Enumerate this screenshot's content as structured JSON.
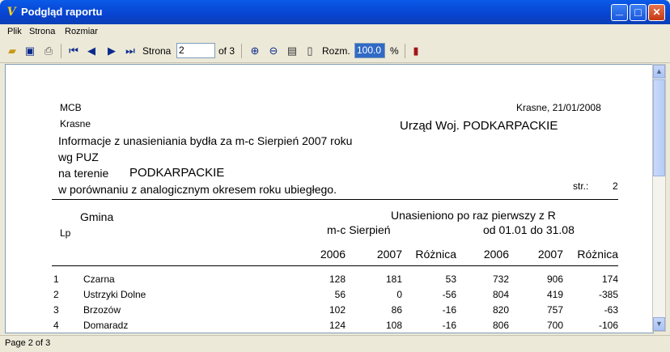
{
  "window": {
    "title": "Podgląd raportu",
    "minimize": "_",
    "maximize": "□",
    "close": "✕"
  },
  "menu": [
    "Plik",
    "Strona",
    "Rozmiar"
  ],
  "toolbar": {
    "page_label": "Strona",
    "page_value": "2",
    "page_of": "of 3",
    "zoom_label": "Rozm.",
    "zoom_value": "100.0",
    "zoom_unit": "%"
  },
  "report": {
    "company": "MCB",
    "place_date": "Krasne, 21/01/2008",
    "city": "Krasne",
    "recipient": "Urząd Woj. PODKARPACKIE",
    "line1": "Informacje z unasieniania bydła za  m-c Sierpień 2007 roku",
    "line2": "wg PUZ",
    "line3_label": "na terenie",
    "line3_region": "PODKARPACKIE",
    "line4": "w porównaniu z analogicznym okresem roku ubiegłego.",
    "page_label": "str.:",
    "page_number": "2",
    "header": {
      "gmina": "Gmina",
      "lp": "Lp",
      "group_title": "Unasieniono po raz pierwszy z R",
      "month_label": "m-c  Sierpień",
      "range_label": "od 01.01 do 31.08",
      "columns": [
        "2006",
        "2007",
        "Różnica",
        "2006",
        "2007",
        "Różnica"
      ]
    },
    "rows": [
      {
        "lp": "1",
        "gmina": "Czarna",
        "v": [
          "128",
          "181",
          "53",
          "732",
          "906",
          "174"
        ]
      },
      {
        "lp": "2",
        "gmina": "Ustrzyki Dolne",
        "v": [
          "56",
          "0",
          "-56",
          "804",
          "419",
          "-385"
        ]
      },
      {
        "lp": "3",
        "gmina": "Brzozów",
        "v": [
          "102",
          "86",
          "-16",
          "820",
          "757",
          "-63"
        ]
      },
      {
        "lp": "4",
        "gmina": "Domaradz",
        "v": [
          "124",
          "108",
          "-16",
          "806",
          "700",
          "-106"
        ]
      }
    ]
  },
  "status": "Page 2 of 3"
}
